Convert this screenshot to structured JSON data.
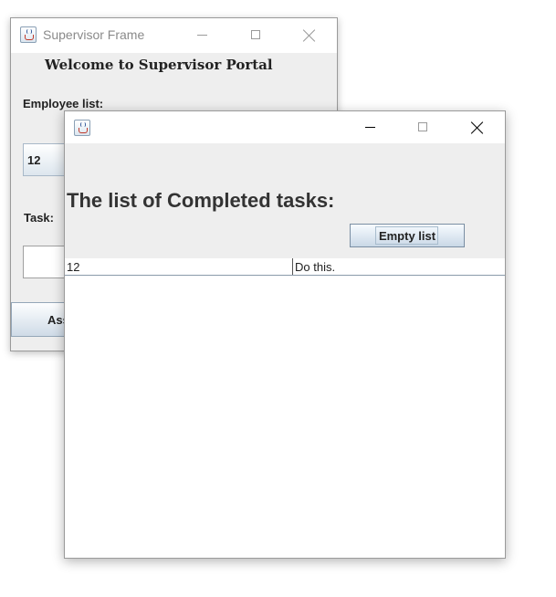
{
  "supervisor_window": {
    "title": "Supervisor Frame",
    "welcome": "Welcome to Supervisor Portal",
    "employee_label": "Employee list:",
    "employee_selected": "12",
    "task_label": "Task:",
    "task_value": "",
    "assign_button_partial": "Ass"
  },
  "tasks_window": {
    "title": "",
    "heading": "The list of Completed tasks:",
    "empty_button": "Empty list",
    "rows": [
      {
        "employee": "12",
        "task": "Do this."
      }
    ]
  },
  "icons": [
    "java-app-icon",
    "minimize-icon",
    "maximize-icon",
    "close-icon"
  ]
}
